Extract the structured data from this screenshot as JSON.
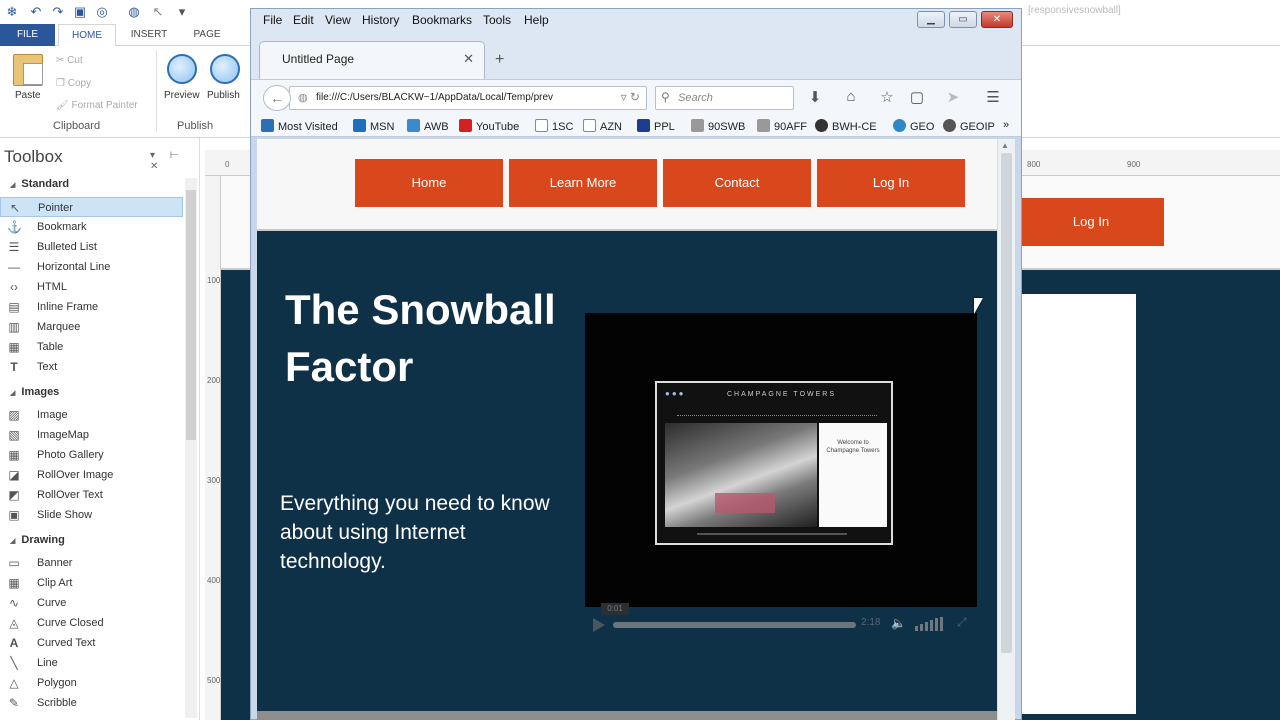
{
  "designer": {
    "title_right": "[responsivesnowball]",
    "ribbon_tabs": [
      "FILE",
      "HOME",
      "INSERT",
      "PAGE"
    ],
    "clipboard": {
      "paste": "Paste",
      "cut": "Cut",
      "copy": "Copy",
      "format_painter": "Format Painter",
      "group": "Clipboard"
    },
    "publish": {
      "preview": "Preview",
      "publish": "Publish",
      "group": "Publish"
    },
    "toolbox": {
      "title": "Toolbox",
      "categories": [
        {
          "name": "Standard",
          "items": [
            "Pointer",
            "Bookmark",
            "Bulleted List",
            "Horizontal Line",
            "HTML",
            "Inline Frame",
            "Marquee",
            "Table",
            "Text"
          ]
        },
        {
          "name": "Images",
          "items": [
            "Image",
            "ImageMap",
            "Photo Gallery",
            "RollOver Image",
            "RollOver Text",
            "Slide Show"
          ]
        },
        {
          "name": "Drawing",
          "items": [
            "Banner",
            "Clip Art",
            "Curve",
            "Curve Closed",
            "Curved Text",
            "Line",
            "Polygon",
            "Scribble"
          ]
        }
      ],
      "selected": "Pointer"
    },
    "ruler_top": [
      "0",
      "800",
      "900"
    ],
    "ruler_left": [
      "100",
      "200",
      "300",
      "400",
      "500"
    ],
    "canvas_login": "Log In"
  },
  "browser": {
    "menus": [
      "File",
      "Edit",
      "View",
      "History",
      "Bookmarks",
      "Tools",
      "Help"
    ],
    "tab_title": "Untitled Page",
    "url": "file:///C:/Users/BLACKW~1/AppData/Local/Temp/prev",
    "search_placeholder": "Search",
    "bookmarks": [
      "Most Visited",
      "MSN",
      "AWB",
      "YouTube",
      "1SC",
      "AZN",
      "PPL",
      "90SWB",
      "90AFF",
      "BWH-CE",
      "GEO",
      "GEOIP"
    ],
    "colors": {
      "accent": "#d9481c",
      "page_bg": "#0f3148"
    }
  },
  "site": {
    "nav": [
      "Home",
      "Learn More",
      "Contact",
      "Log In"
    ],
    "hero_title": "The Snowball Factor",
    "hero_subtitle": "Everything you need to know about using Internet technology.",
    "video": {
      "current_time": "0:01",
      "duration": "2:18",
      "progress": 0.01,
      "thumbnail_brand": "CHAMPAGNE TOWERS",
      "thumbnail_panel": "Welcome to Champagne Towers"
    }
  }
}
